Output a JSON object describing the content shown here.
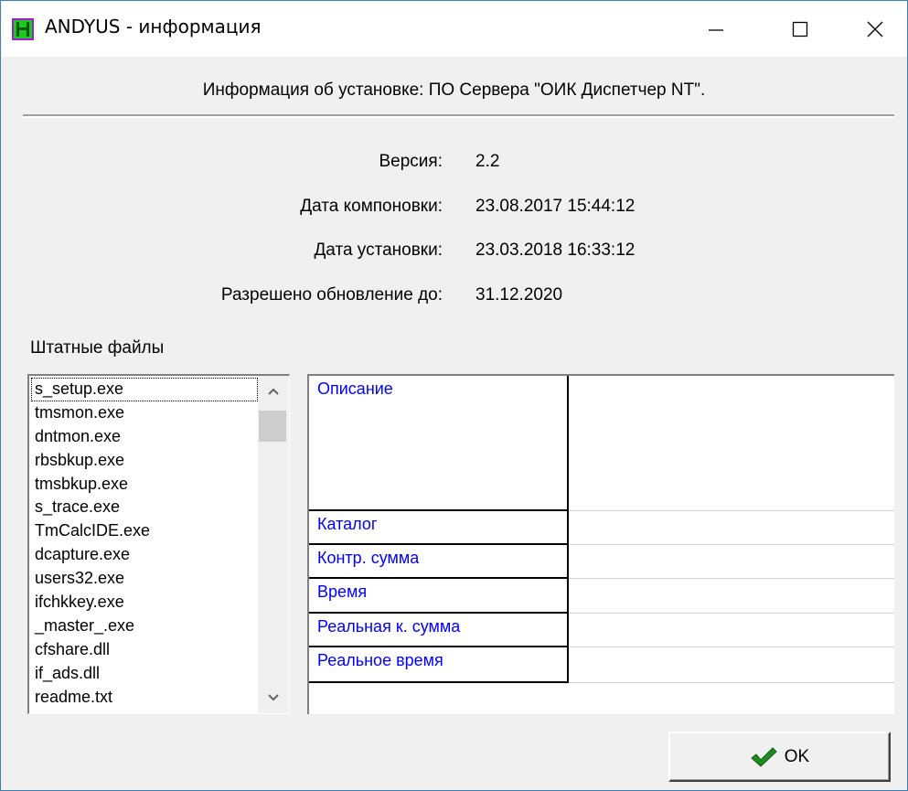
{
  "window": {
    "title": "ANDYUS - информация",
    "controls": {
      "minimize": "minimize-icon",
      "maximize": "maximize-icon",
      "close": "close-icon"
    }
  },
  "header": {
    "text": "Информация об установке:  ПО Сервера \"ОИК Диспетчер NT\"."
  },
  "info": [
    {
      "label": "Версия:",
      "value": "2.2"
    },
    {
      "label": "Дата компоновки:",
      "value": "23.08.2017 15:44:12"
    },
    {
      "label": "Дата установки:",
      "value": "23.03.2018 16:33:12"
    },
    {
      "label": "Разрешено обновление до:",
      "value": "31.12.2020"
    }
  ],
  "files": {
    "label": "Штатные файлы",
    "items": [
      "s_setup.exe",
      "tmsmon.exe",
      "dntmon.exe",
      "rbsbkup.exe",
      "tmsbkup.exe",
      "s_trace.exe",
      "TmCalcIDE.exe",
      "dcapture.exe",
      "users32.exe",
      "ifchkkey.exe",
      "_master_.exe",
      "cfshare.dll",
      "if_ads.dll",
      "readme.txt"
    ],
    "selected": "s_setup.exe"
  },
  "details": {
    "rows": [
      {
        "label": "Описание",
        "value": ""
      },
      {
        "label": "Каталог",
        "value": ""
      },
      {
        "label": "Контр. сумма",
        "value": ""
      },
      {
        "label": "Время",
        "value": ""
      },
      {
        "label": "Реальная к. сумма",
        "value": ""
      },
      {
        "label": "Реальное время",
        "value": ""
      }
    ]
  },
  "buttons": {
    "ok": "OK"
  },
  "colors": {
    "label_blue": "#0000ff",
    "window_bg": "#f0f0f0",
    "border_blue": "#3c7fb1"
  }
}
